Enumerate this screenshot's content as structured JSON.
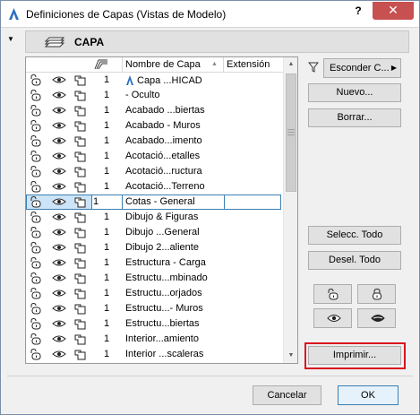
{
  "window": {
    "title": "Definiciones de Capas (Vistas de Modelo)",
    "help_label": "?",
    "close_label": "✕"
  },
  "header": {
    "label": "CAPA"
  },
  "columns": {
    "name": "Nombre de Capa",
    "extension": "Extensión"
  },
  "layers": [
    {
      "num": "1",
      "name": "Capa ...HICAD",
      "locked": true
    },
    {
      "num": "1",
      "name": "- Oculto"
    },
    {
      "num": "1",
      "name": "Acabado ...biertas"
    },
    {
      "num": "1",
      "name": "Acabado - Muros"
    },
    {
      "num": "1",
      "name": "Acabado...imento"
    },
    {
      "num": "1",
      "name": "Acotació...etalles"
    },
    {
      "num": "1",
      "name": "Acotació...ructura"
    },
    {
      "num": "1",
      "name": "Acotació...Terreno"
    },
    {
      "num": "1",
      "name": "Cotas - General",
      "selected": true
    },
    {
      "num": "1",
      "name": "Dibujo & Figuras"
    },
    {
      "num": "1",
      "name": "Dibujo ...General"
    },
    {
      "num": "1",
      "name": "Dibujo 2...aliente"
    },
    {
      "num": "1",
      "name": "Estructura - Carga"
    },
    {
      "num": "1",
      "name": "Estructu...mbinado"
    },
    {
      "num": "1",
      "name": "Estructu...orjados"
    },
    {
      "num": "1",
      "name": "Estructu...- Muros"
    },
    {
      "num": "1",
      "name": "Estructu...biertas"
    },
    {
      "num": "1",
      "name": "Interior...amiento"
    },
    {
      "num": "1",
      "name": "Interior ...scaleras"
    }
  ],
  "buttons": {
    "hide": "Esconder C...",
    "new": "Nuevo...",
    "delete": "Borrar...",
    "select_all": "Selecc. Todo",
    "deselect_all": "Desel. Todo",
    "print": "Imprimir...",
    "cancel": "Cancelar",
    "ok": "OK"
  },
  "colors": {
    "selection_fill": "#cce4f7",
    "selection_border": "#3c7fb1",
    "highlight": "#d9141e",
    "close_button": "#c75050"
  }
}
